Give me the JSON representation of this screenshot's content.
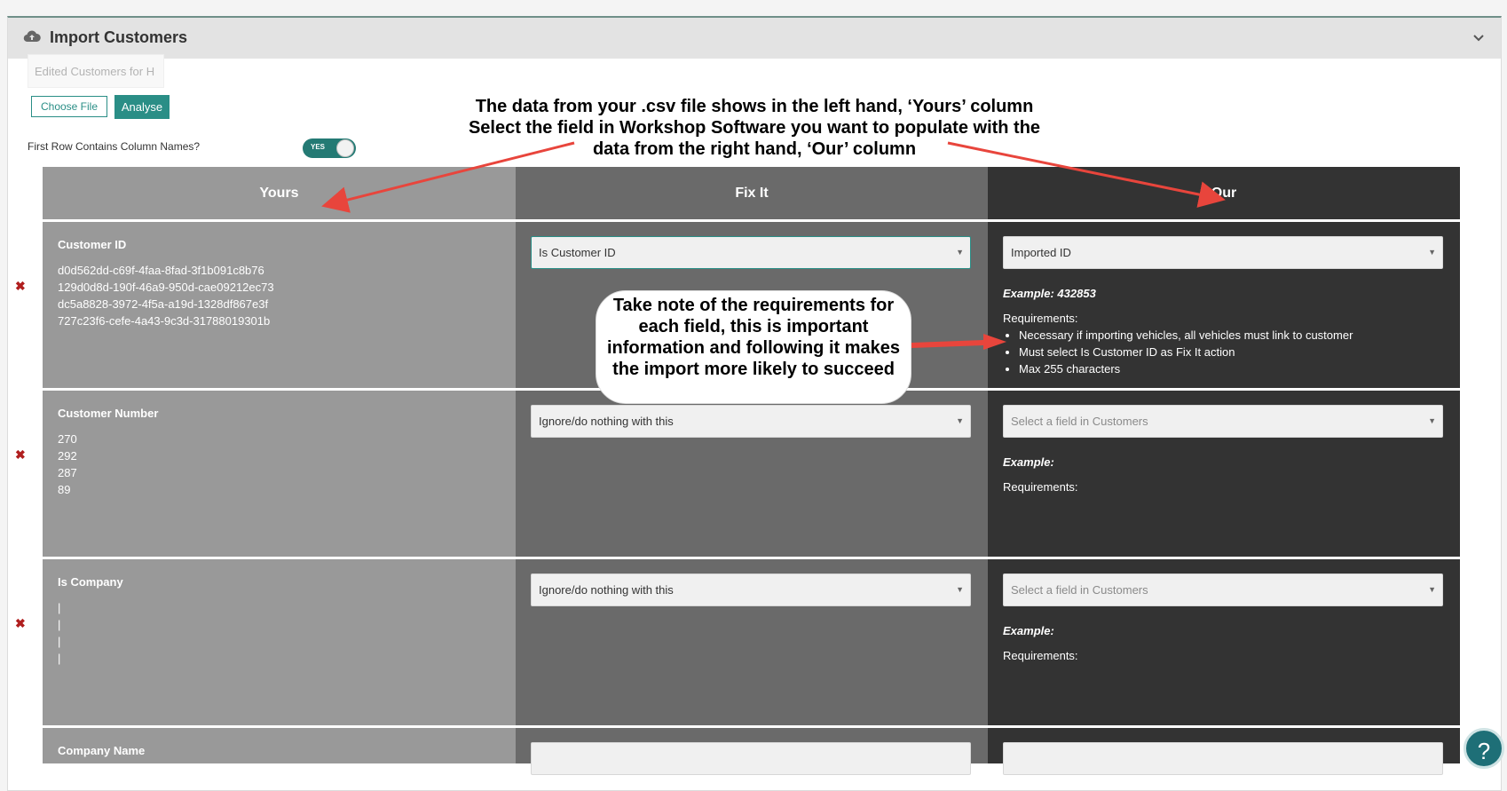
{
  "panel": {
    "title": "Import Customers",
    "icon": "cloud-upload-icon",
    "collapse_icon": "chevron-down-icon"
  },
  "file": {
    "name": "Edited Customers for H",
    "choose_label": "Choose File",
    "analyse_label": "Analyse"
  },
  "options": {
    "first_row_label": "First Row Contains Column Names?",
    "toggle_label": "YES",
    "toggle_on": true
  },
  "columns": {
    "yours": "Yours",
    "fix": "Fix It",
    "our": "Our"
  },
  "rows": [
    {
      "field": "Customer ID",
      "samples": [
        "d0d562dd-c69f-4faa-8fad-3f1b091c8b76",
        "129d0d8d-190f-46a9-950d-cae09212ec73",
        "dc5a8828-3972-4f5a-a19d-1328df867e3f",
        "727c23f6-cefe-4a43-9c3d-31788019301b"
      ],
      "fix_action": "Is Customer ID",
      "our_field": "Imported ID",
      "example": "Example:  432853",
      "requirements_label": "Requirements:",
      "requirements": [
        "Necessary if importing vehicles, all vehicles must link to customer",
        "Must select Is Customer ID as Fix It action",
        "Max 255 characters"
      ]
    },
    {
      "field": "Customer Number",
      "samples": [
        "270",
        "292",
        "287",
        "89"
      ],
      "fix_action": "Ignore/do nothing with this",
      "our_field": "Select a field in Customers",
      "example": "Example:",
      "requirements_label": "Requirements:"
    },
    {
      "field": "Is Company",
      "samples": [
        "|",
        "|",
        "|",
        "|"
      ],
      "fix_action": "Ignore/do nothing with this",
      "our_field": "Select a field in Customers",
      "example": "Example:",
      "requirements_label": "Requirements:"
    },
    {
      "field": "Company Name"
    }
  ],
  "annotations": {
    "top_line1": "The data from your .csv file shows in the left hand, ‘Yours’ column",
    "top_line2": "Select the field in Workshop Software you want to populate with the",
    "top_line3": "data from the right hand, ‘Our’ column",
    "bubble": "Take note of the requirements for each field, this is important information and following it makes the import more likely to succeed",
    "arrow_color": "#e8453c"
  },
  "help": {
    "label": "?"
  },
  "colors": {
    "accent": "#2a8e86",
    "yours_bg": "#999999",
    "fix_bg": "#6a6a6a",
    "our_bg": "#333333",
    "remove": "#b01e1e"
  }
}
